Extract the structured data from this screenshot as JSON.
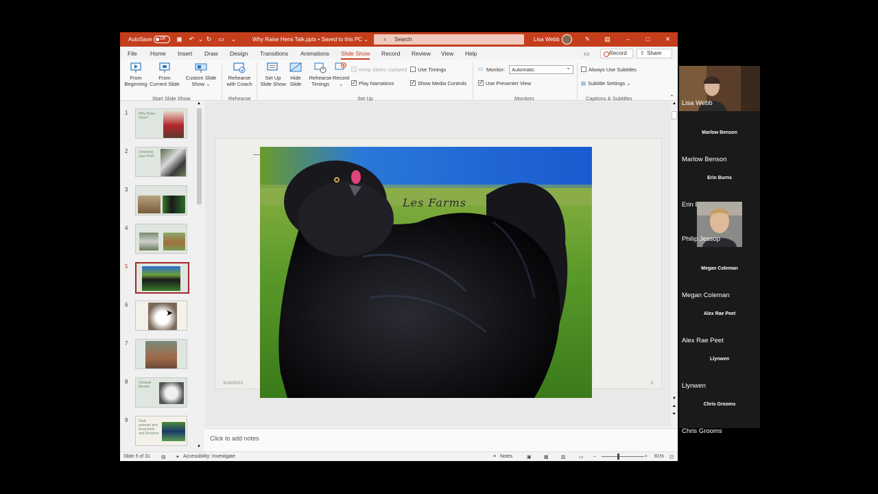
{
  "titlebar": {
    "autosave_label": "AutoSave",
    "autosave_state": "Off",
    "doc_title": "Why Raise Hens Talk.pptx • Saved to this PC ⌄",
    "search_placeholder": "Search",
    "user_name": "Lisa Webb"
  },
  "menu": {
    "items": [
      "File",
      "Home",
      "Insert",
      "Draw",
      "Design",
      "Transitions",
      "Animations",
      "Slide Show",
      "Record",
      "Review",
      "View",
      "Help"
    ],
    "record_button": "Record",
    "share_button": "Share"
  },
  "ribbon": {
    "from_beginning": [
      "From",
      "Beginning"
    ],
    "from_current": [
      "From",
      "Current Slide"
    ],
    "custom_show": [
      "Custom Slide",
      "Show ⌄"
    ],
    "group_start": "Start Slide Show",
    "rehearse_coach": [
      "Rehearse",
      "with Coach"
    ],
    "group_rehearse": "Rehearse",
    "setup_show": [
      "Set Up",
      "Slide Show"
    ],
    "hide_slide": [
      "Hide",
      "Slide"
    ],
    "rehearse_timings": [
      "Rehearse",
      "Timings"
    ],
    "record": [
      "Record",
      "⌄"
    ],
    "keep_slides_updated": "Keep Slides Updated",
    "play_narrations": "Play Narrations",
    "use_timings": "Use Timings",
    "show_media_controls": "Show Media Controls",
    "group_setup": "Set Up",
    "monitor_label": "Monitor:",
    "monitor_value": "Automatic",
    "use_presenter_view": "Use Presenter View",
    "group_monitors": "Monitors",
    "always_use_subtitles": "Always Use Subtitles",
    "subtitle_settings": "Subtitle Settings ⌄",
    "group_captions": "Captions & Subtitles"
  },
  "thumbnails": [
    {
      "num": "1",
      "title": "Why Raise Hens?",
      "selected": false
    },
    {
      "num": "2",
      "title": "Choosing your Flock",
      "selected": false
    },
    {
      "num": "3",
      "title": "",
      "selected": false
    },
    {
      "num": "4",
      "title": "",
      "selected": false
    },
    {
      "num": "5",
      "title": "",
      "selected": true
    },
    {
      "num": "6",
      "title": "",
      "selected": false
    },
    {
      "num": "7",
      "title": "",
      "selected": false
    },
    {
      "num": "8",
      "title": "Unusual Breeds",
      "selected": false
    },
    {
      "num": "9",
      "title": "Dual-purpose and meat birds and Roosters",
      "selected": false
    }
  ],
  "slide": {
    "caption": "Les Farms",
    "date": "3/16/2023",
    "page_number": "5"
  },
  "notes_placeholder": "Click to add notes",
  "status": {
    "slide_info": "Slide 5 of 31",
    "accessibility": "Accessibility: Investigate",
    "notes": "Notes",
    "zoom": "81%"
  },
  "participants": [
    {
      "name": "Lisa Webb",
      "label": "",
      "video": true
    },
    {
      "name": "Marlow Benson",
      "label": "Marlow Benson",
      "video": false
    },
    {
      "name": "Erin Burns",
      "label": "Erin Burns",
      "video": false
    },
    {
      "name": "Philip Jessop",
      "label": "",
      "video": true
    },
    {
      "name": "Megan Coleman",
      "label": "Megan Coleman",
      "video": false
    },
    {
      "name": "Alex Rae Peet",
      "label": "Alex Rae Peet",
      "video": false
    },
    {
      "name": "Llynwen",
      "label": "Llynwen",
      "video": false
    },
    {
      "name": "Chris Grooms",
      "label": "Chris Grooms",
      "video": false
    }
  ],
  "colors": {
    "accent": "#c43e1c",
    "selected_border": "#a4262c",
    "panel_bg": "#1a1a1a"
  }
}
